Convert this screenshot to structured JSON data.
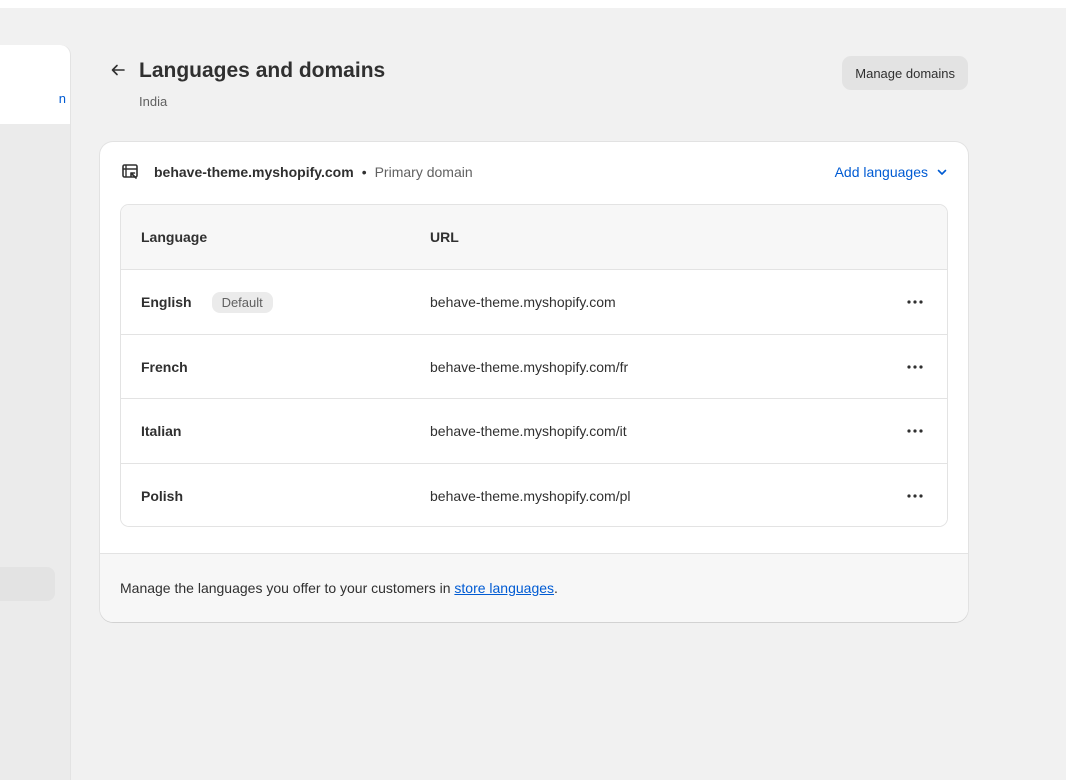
{
  "page": {
    "title": "Languages and domains",
    "subtitle": "India",
    "manage_button": "Manage domains",
    "back_icon": "arrow-left-icon"
  },
  "sidebar": {
    "active_item_partial": "n"
  },
  "domain": {
    "name": "behave-theme.myshopify.com",
    "separator": "•",
    "tag": "Primary domain",
    "add_languages": "Add languages"
  },
  "table": {
    "headers": [
      "Language",
      "URL"
    ],
    "rows": [
      {
        "language": "English",
        "badge": "Default",
        "url": "behave-theme.myshopify.com"
      },
      {
        "language": "French",
        "url": "behave-theme.myshopify.com/fr"
      },
      {
        "language": "Italian",
        "url": "behave-theme.myshopify.com/it"
      },
      {
        "language": "Polish",
        "url": "behave-theme.myshopify.com/pl"
      }
    ]
  },
  "footer": {
    "text_before": "Manage the languages you offer to your customers in ",
    "link": "store languages",
    "text_after": "."
  },
  "colors": {
    "accent": "#005bd3",
    "background": "#f1f1f1",
    "card": "#ffffff",
    "text": "#303030",
    "muted": "#616161"
  }
}
